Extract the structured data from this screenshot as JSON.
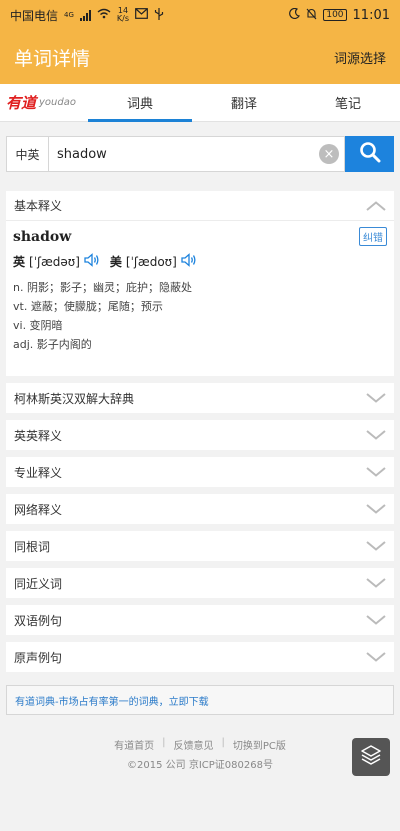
{
  "status_bar": {
    "carrier": "中国电信",
    "network": "4G",
    "speed_value": "14",
    "speed_unit": "K/s",
    "battery": "100",
    "time": "11:01"
  },
  "app_bar": {
    "title": "单词详情",
    "source_button": "词源选择"
  },
  "tabs": {
    "logo_cn": "有道",
    "logo_en": "youdao",
    "items": [
      {
        "label": "词典",
        "active": true
      },
      {
        "label": "翻译",
        "active": false
      },
      {
        "label": "笔记",
        "active": false
      }
    ]
  },
  "search": {
    "lang": "中英",
    "query": "shadow",
    "clear_glyph": "×"
  },
  "basic": {
    "header": "基本释义",
    "word": "shadow",
    "report": "纠错",
    "uk_label": "英",
    "uk_phonetic": "[ˈʃædəʊ]",
    "us_label": "美",
    "us_phonetic": "[ˈʃædoʊ]",
    "definitions": [
      "n. 阴影；影子；幽灵；庇护；隐蔽处",
      "vt. 遮蔽；使朦胧；尾随；预示",
      "vi. 变阴暗",
      "adj. 影子内阁的"
    ]
  },
  "sections": [
    "柯林斯英汉双解大辞典",
    "英英释义",
    "专业释义",
    "网络释义",
    "同根词",
    "同近义词",
    "双语例句",
    "原声例句"
  ],
  "ad": "有道词典-市场占有率第一的词典，立即下载",
  "footer": {
    "link_home": "有道首页",
    "link_feedback": "反馈意见",
    "link_pc": "切换到PC版",
    "sep": "|",
    "copyright": "©2015 公司 京ICP证080268号"
  },
  "colors": {
    "header_bg": "#f5b545",
    "accent_blue": "#1d83dd",
    "logo_red": "#e02020"
  }
}
